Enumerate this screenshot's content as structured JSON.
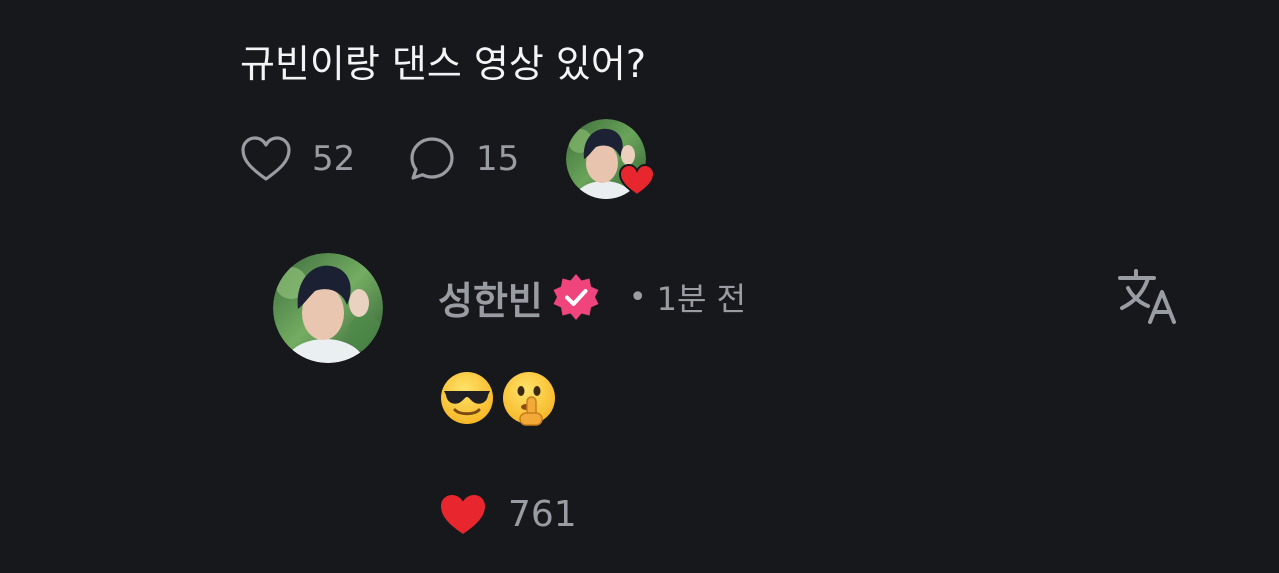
{
  "post": {
    "text": "규빈이랑 댄스 영상 있어?",
    "likes": "52",
    "comments": "15"
  },
  "reply": {
    "author": "성한빈",
    "separator": "•",
    "time": "1분 전",
    "emojis": [
      "smiling-face-with-sunglasses",
      "shushing-face"
    ],
    "likes": "761"
  },
  "colors": {
    "background": "#16181c",
    "muted_text": "#9a9ca3",
    "heart_red": "#e8262e",
    "verified_pink": "#f0447c"
  }
}
